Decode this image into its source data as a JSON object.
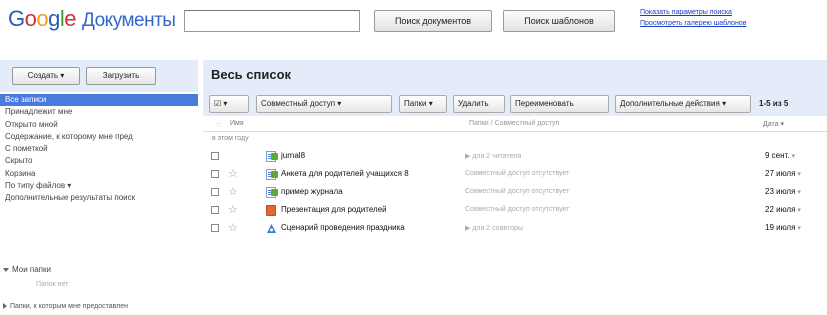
{
  "header": {
    "logo_google": "Google",
    "logo_product": "Документы",
    "search_value": "",
    "search_docs_button": "Поиск документов",
    "search_templates_button": "Поиск шаблонов",
    "link_search_options": "Показать параметры поиска",
    "link_browse_templates": "Просмотреть галерею шаблонов"
  },
  "sidebar": {
    "create_button": "Создать ▾",
    "upload_button": "Загрузить",
    "items": [
      {
        "label": "Все записи"
      },
      {
        "label": "Принадлежит мне"
      },
      {
        "label": "Открыто мной"
      },
      {
        "label": "Содержание, к которому мне пред"
      },
      {
        "label": "С пометкой"
      },
      {
        "label": "Скрыто"
      },
      {
        "label": "Корзина"
      },
      {
        "label": "По типу файлов ▾"
      },
      {
        "label": "Дополнительные результаты поиск"
      }
    ],
    "my_folders": "Мои папки",
    "no_folders": "Папок нет",
    "shared_folders": "Папки, к которым мне предоставлен"
  },
  "main": {
    "title": "Весь список",
    "toolbar": {
      "select": "☑ ▾",
      "share": "Совместный доступ ▾",
      "folders": "Папки ▾",
      "delete": "Удалить",
      "rename": "Переименовать",
      "more_actions": "Дополнительные действия ▾",
      "pagination": "1-5 из 5"
    },
    "columns": {
      "star": "☆",
      "name": "Имя",
      "folders_sharing": "Папки / Совместный доступ",
      "date": "Дата ▾"
    },
    "group_label": "в этом году",
    "rows": [
      {
        "name": "jurnal8",
        "sharing": "▶ для 2 читателя",
        "date": "9 сент.",
        "type": "sheet",
        "starred": false
      },
      {
        "name": "Анкета для родителей учащихся 8",
        "sharing": "Совместный доступ отсутствует",
        "date": "27 июля",
        "type": "sheet",
        "starred": true
      },
      {
        "name": "пример журнала",
        "sharing": "Совместный доступ отсутствует",
        "date": "23 июля",
        "type": "sheet",
        "starred": true
      },
      {
        "name": "Презентация для родителей",
        "sharing": "Совместный доступ отсутствует",
        "date": "22 июля",
        "type": "presentation",
        "starred": true
      },
      {
        "name": "Сценарий проведения праздника",
        "sharing": "▶ для 2 соавторы",
        "date": "19 июля",
        "type": "drawing",
        "starred": true
      }
    ]
  },
  "colors": {
    "header_bg": "#e5ecf9",
    "selected_nav": "#4a7bdc",
    "link": "#1a3dc1"
  }
}
